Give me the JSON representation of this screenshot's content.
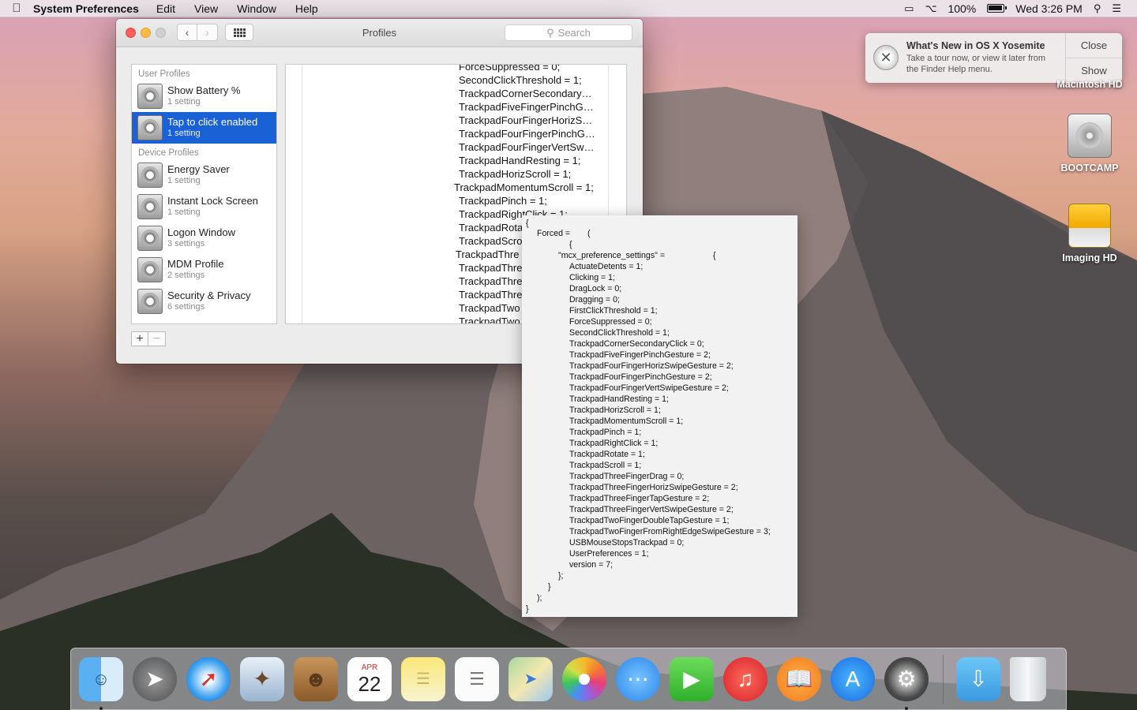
{
  "menubar": {
    "app": "System Preferences",
    "items": [
      "Edit",
      "View",
      "Window",
      "Help"
    ],
    "battery": "100%",
    "clock": "Wed 3:26 PM"
  },
  "window": {
    "title": "Profiles",
    "search_placeholder": "Search",
    "user_profiles_header": "User Profiles",
    "device_profiles_header": "Device Profiles",
    "user_profiles": [
      {
        "name": "Show Battery %",
        "count": "1 setting"
      },
      {
        "name": "Tap to click enabled",
        "count": "1 setting"
      }
    ],
    "device_profiles": [
      {
        "name": "Energy Saver",
        "count": "1 setting"
      },
      {
        "name": "Instant Lock Screen",
        "count": "1 setting"
      },
      {
        "name": "Logon Window",
        "count": "3 settings"
      },
      {
        "name": "MDM Profile",
        "count": "2 settings"
      },
      {
        "name": "Security & Privacy",
        "count": "6 settings"
      }
    ],
    "add_label": "+",
    "remove_label": "−",
    "detail_lines": [
      "ForceSuppressed = 0;",
      "SecondClickThreshold = 1;",
      "TrackpadCornerSecondary…",
      "TrackpadFiveFingerPinchG…",
      "TrackpadFourFingerHorizS…",
      "TrackpadFourFingerPinchG…",
      "TrackpadFourFingerVertSw…",
      "TrackpadHandResting = 1;",
      "TrackpadHorizScroll = 1;",
      "TrackpadMomentumScroll = 1;",
      "TrackpadPinch = 1;",
      "TrackpadRightClick = 1;",
      "TrackpadRota",
      "TrackpadScro",
      "TrackpadThre",
      "TrackpadThre",
      "TrackpadThre",
      "TrackpadThre",
      "TrackpadTwo",
      "TrackpadTwo"
    ]
  },
  "plist": {
    "open_brace": "{",
    "forced_line": "Forced =",
    "forced_paren": "(",
    "inner_brace": "{",
    "mcx_key": "\"mcx_preference_settings\" =",
    "mcx_brace": "{",
    "settings": [
      "ActuateDetents = 1;",
      "Clicking = 1;",
      "DragLock = 0;",
      "Dragging = 0;",
      "FirstClickThreshold = 1;",
      "ForceSuppressed = 0;",
      "SecondClickThreshold = 1;",
      "TrackpadCornerSecondaryClick = 0;",
      "TrackpadFiveFingerPinchGesture = 2;",
      "TrackpadFourFingerHorizSwipeGesture = 2;",
      "TrackpadFourFingerPinchGesture = 2;",
      "TrackpadFourFingerVertSwipeGesture = 2;",
      "TrackpadHandResting = 1;",
      "TrackpadHorizScroll = 1;",
      "TrackpadMomentumScroll = 1;",
      "TrackpadPinch = 1;",
      "TrackpadRightClick = 1;",
      "TrackpadRotate = 1;",
      "TrackpadScroll = 1;",
      "TrackpadThreeFingerDrag = 0;",
      "TrackpadThreeFingerHorizSwipeGesture = 2;",
      "TrackpadThreeFingerTapGesture = 2;",
      "TrackpadThreeFingerVertSwipeGesture = 2;",
      "TrackpadTwoFingerDoubleTapGesture = 1;",
      "TrackpadTwoFingerFromRightEdgeSwipeGesture = 3;",
      "USBMouseStopsTrackpad = 0;",
      "UserPreferences = 1;",
      "version = 7;"
    ],
    "close_inner": "};",
    "close_brace": "}",
    "close_paren": ");",
    "close_outer": "}"
  },
  "notification": {
    "title": "What's New in OS X Yosemite",
    "body": "Take a tour now, or view it later from the Finder Help menu.",
    "close_label": "Close",
    "show_label": "Show"
  },
  "desktop": {
    "disks": [
      "Macintosh HD",
      "BOOTCAMP",
      "Imaging HD"
    ]
  },
  "dock": {
    "calendar_month": "APR",
    "calendar_day": "22",
    "apps": [
      "finder",
      "launchpad",
      "safari",
      "mail",
      "contacts",
      "calendar",
      "notes",
      "reminders",
      "maps",
      "photos",
      "messages",
      "facetime",
      "itunes",
      "ibooks",
      "app-store",
      "system-preferences",
      "downloads",
      "trash"
    ]
  }
}
